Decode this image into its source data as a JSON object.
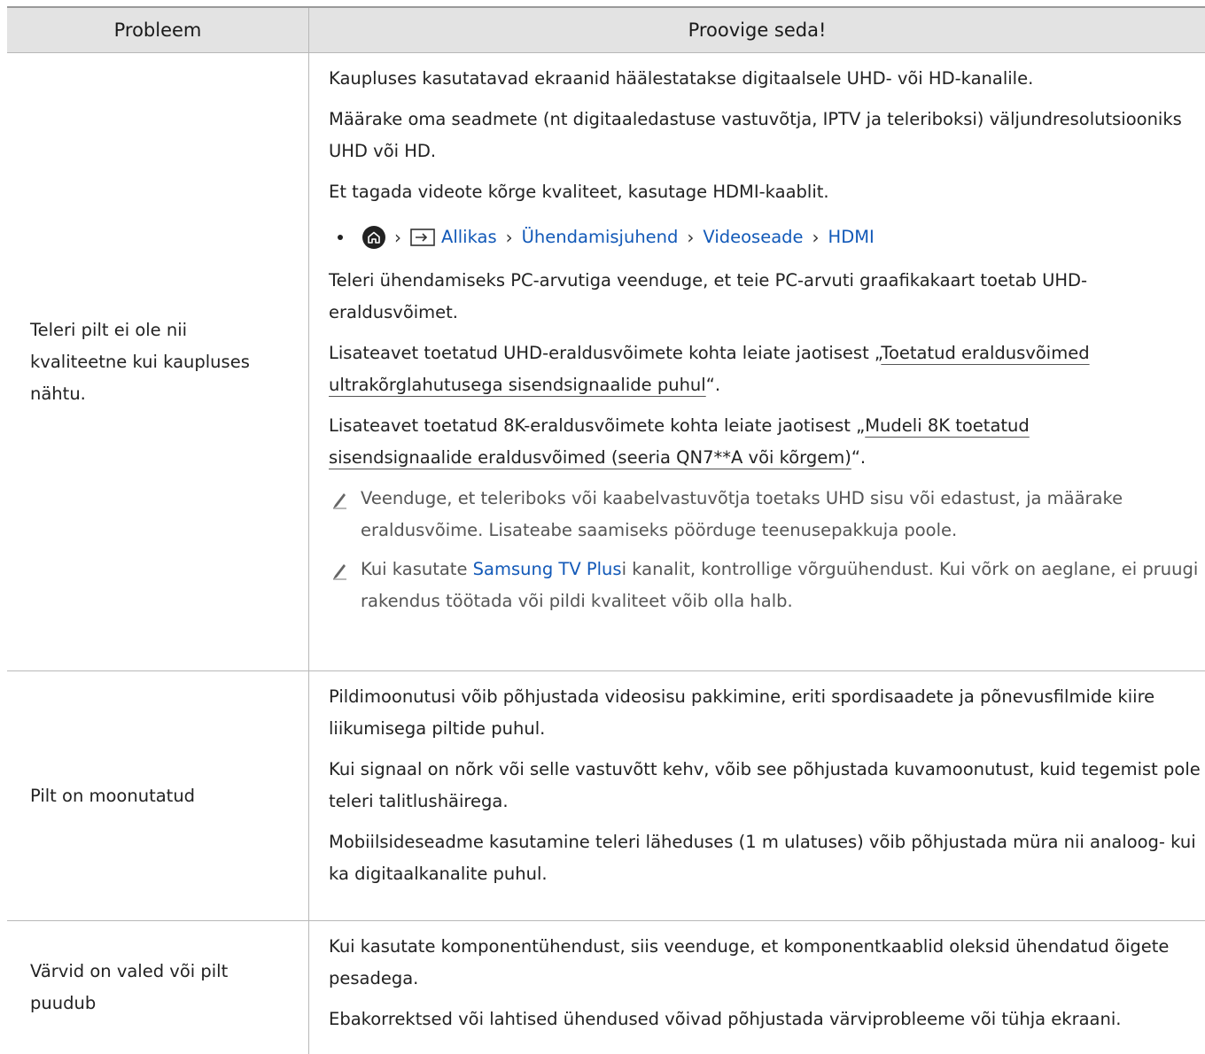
{
  "header": {
    "col1": "Probleem",
    "col2": "Proovige seda!"
  },
  "rows": [
    {
      "problem": "Teleri pilt ei ole nii kvaliteetne kui kaupluses nähtu.",
      "p1": "Kaupluses kasutatavad ekraanid häälestatakse digitaalsele UHD- või HD-kanalile.",
      "p2": "Määrake oma seadmete (nt digitaaledastuse vastuvõtja, IPTV ja teleriboksi) väljundresolutsiooniks UHD või HD.",
      "p3": "Et tagada videote kõrge kvaliteet, kasutage HDMI-kaablit.",
      "path": {
        "home_icon": "home-icon",
        "source_icon": "source-input-icon",
        "item1": "Allikas",
        "item2": "Ühendamisjuhend",
        "item3": "Videoseade",
        "item4": "HDMI"
      },
      "p4": "Teleri ühendamiseks PC-arvutiga veenduge, et teie PC-arvuti graafikakaart toetab UHD-eraldusvõimet.",
      "p5_pre": "Lisateavet toetatud UHD-eraldusvõimete kohta leiate jaotisest „",
      "p5_link_a": "Toetatud eraldusvõimed",
      "p5_link_b": "ultrakõrglahutusega sisendsignaalide puhul",
      "p5_post": "“.",
      "p6_pre": "Lisateavet toetatud 8K-eraldusvõimete kohta leiate jaotisest „",
      "p6_link_a": "Mudeli 8K toetatud",
      "p6_link_b": "sisendsignaalide eraldusvõimed (seeria QN7**A või kõrgem)",
      "p6_post": "“.",
      "note1": "Veenduge, et teleriboks või kaabelvastuvõtja toetaks UHD sisu või edastust, ja määrake eraldusvõime. Lisateabe saamiseks pöörduge teenusepakkuja poole.",
      "note2_pre": "Kui kasutate ",
      "note2_link": "Samsung TV Plus",
      "note2_post": "i kanalit, kontrollige võrguühendust. Kui võrk on aeglane, ei pruugi rakendus töötada või pildi kvaliteet võib olla halb."
    },
    {
      "problem": "Pilt on moonutatud",
      "p1": "Pildimoonutusi võib põhjustada videosisu pakkimine, eriti spordisaadete ja põnevusfilmide kiire liikumisega piltide puhul.",
      "p2": "Kui signaal on nõrk või selle vastuvõtt kehv, võib see põhjustada kuvamoonutust, kuid tegemist pole teleri talitlushäirega.",
      "p3": "Mobiilsideseadme kasutamine teleri läheduses (1 m ulatuses) võib põhjustada müra nii analoog- kui ka digitaalkanalite puhul."
    },
    {
      "problem": "Värvid on valed või pilt puudub",
      "p1": "Kui kasutate komponentühendust, siis veenduge, et komponentkaablid oleksid ühendatud õigete pesadega.",
      "p2": "Ebakorrektsed või lahtised ühendused võivad põhjustada värviprobleeme või tühja ekraani."
    }
  ]
}
